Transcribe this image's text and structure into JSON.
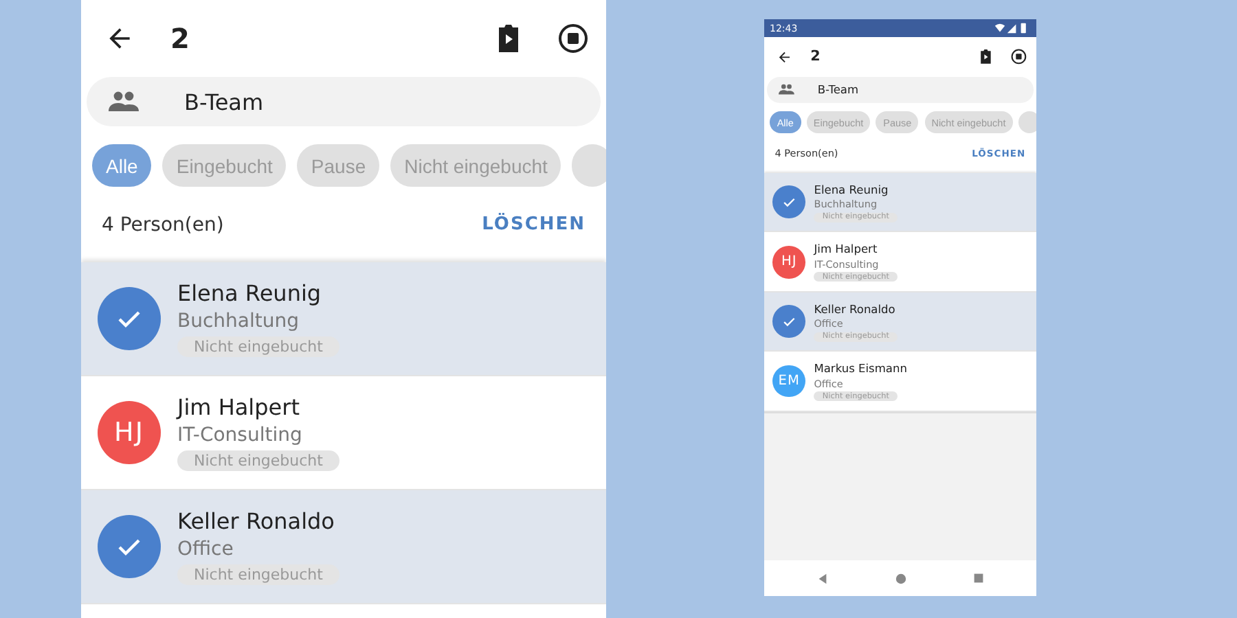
{
  "screens": [
    {
      "kind": "zoomed",
      "header": {
        "title": "2"
      },
      "group": "B-Team",
      "filters": [
        {
          "label": "Alle",
          "selected": true
        },
        {
          "label": "Eingebucht",
          "selected": false
        },
        {
          "label": "Pause",
          "selected": false
        },
        {
          "label": "Nicht eingebucht",
          "selected": false
        }
      ],
      "count": "4 Person(en)",
      "clear_label": "LÖSCHEN",
      "persons": [
        {
          "name": "Elena Reunig",
          "department": "Buchhaltung",
          "status": "Nicht eingebucht",
          "selected": true,
          "color": "#4a80cc"
        },
        {
          "name": "Jim Halpert",
          "department": "IT-Consulting",
          "status": "Nicht eingebucht",
          "selected": false,
          "initials": "HJ",
          "color": "#ef5350"
        },
        {
          "name": "Keller Ronaldo",
          "department": "Office",
          "status": "Nicht eingebucht",
          "selected": true,
          "color": "#4a80cc"
        }
      ]
    },
    {
      "kind": "phone",
      "status_bar": {
        "time": "12:43"
      },
      "header": {
        "title": "2"
      },
      "group": "B-Team",
      "filters": [
        {
          "label": "Alle",
          "selected": true
        },
        {
          "label": "Eingebucht",
          "selected": false
        },
        {
          "label": "Pause",
          "selected": false
        },
        {
          "label": "Nicht eingebucht",
          "selected": false
        }
      ],
      "count": "4 Person(en)",
      "clear_label": "LÖSCHEN",
      "persons": [
        {
          "name": "Elena Reunig",
          "department": "Buchhaltung",
          "status": "Nicht eingebucht",
          "selected": true,
          "color": "#4a80cc"
        },
        {
          "name": "Jim Halpert",
          "department": "IT-Consulting",
          "status": "Nicht eingebucht",
          "selected": false,
          "initials": "HJ",
          "color": "#ef5350"
        },
        {
          "name": "Keller Ronaldo",
          "department": "Office",
          "status": "Nicht eingebucht",
          "selected": true,
          "color": "#4a80cc"
        },
        {
          "name": "Markus Eismann",
          "department": "Office",
          "status": "Nicht eingebucht",
          "selected": false,
          "initials": "EM",
          "color": "#42a5f5"
        }
      ]
    }
  ]
}
